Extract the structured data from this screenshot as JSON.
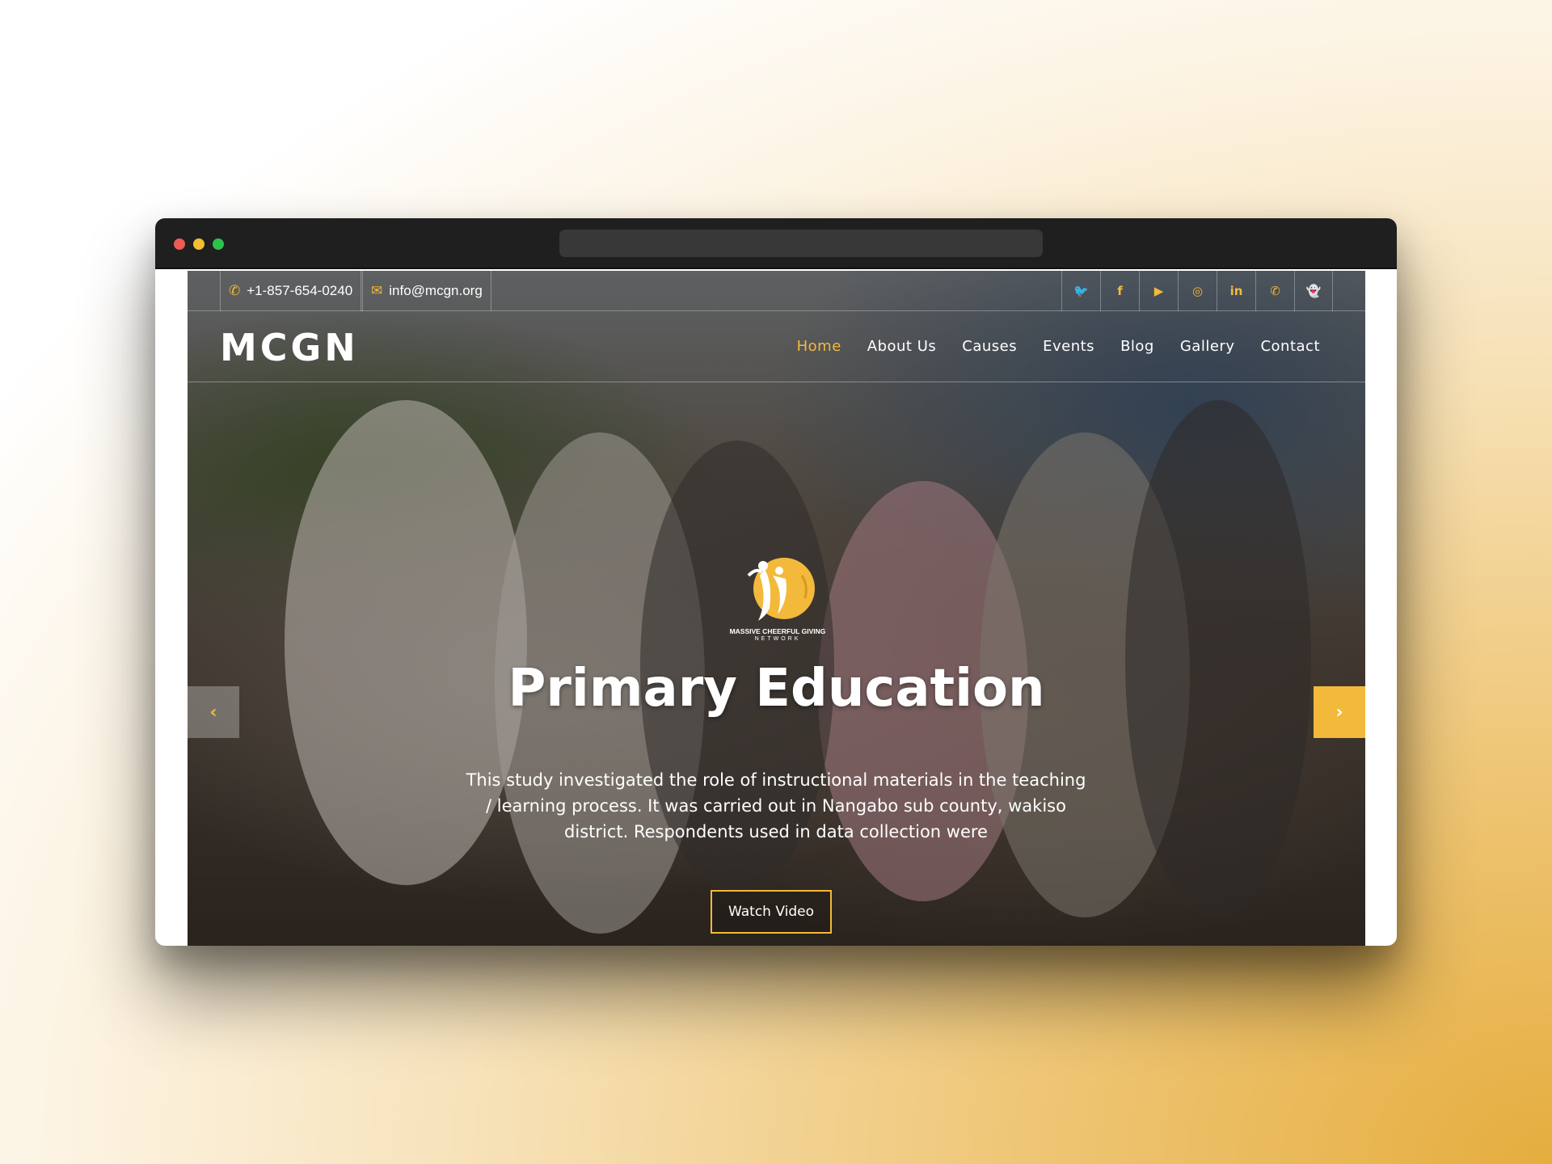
{
  "topbar": {
    "phone": "+1-857-654-0240",
    "email": "info@mcgn.org",
    "phone_icon": "phone-icon",
    "email_icon": "envelope-icon",
    "social": [
      {
        "name": "twitter-icon",
        "glyph": "🐦"
      },
      {
        "name": "facebook-icon",
        "glyph": "f"
      },
      {
        "name": "youtube-icon",
        "glyph": "▶"
      },
      {
        "name": "instagram-icon",
        "glyph": "◎"
      },
      {
        "name": "linkedin-icon",
        "glyph": "in"
      },
      {
        "name": "whatsapp-icon",
        "glyph": "✆"
      },
      {
        "name": "snapchat-icon",
        "glyph": "👻"
      }
    ]
  },
  "nav": {
    "logo": "MCGN",
    "items": [
      "Home",
      "About Us",
      "Causes",
      "Events",
      "Blog",
      "Gallery",
      "Contact"
    ],
    "active": "Home"
  },
  "hero": {
    "emblem_line1": "MASSIVE CHEERFUL GIVING",
    "emblem_line2": "NETWORK",
    "title": "Primary Education",
    "description": "This study investigated the role of instructional materials in the teaching / learning process. It was carried out in Nangabo sub county, wakiso district. Respondents used in data collection were",
    "button": "Watch Video",
    "prev_glyph": "‹",
    "next_glyph": "›"
  },
  "colors": {
    "accent": "#f3b93a",
    "chrome": "#1f1f1f"
  }
}
